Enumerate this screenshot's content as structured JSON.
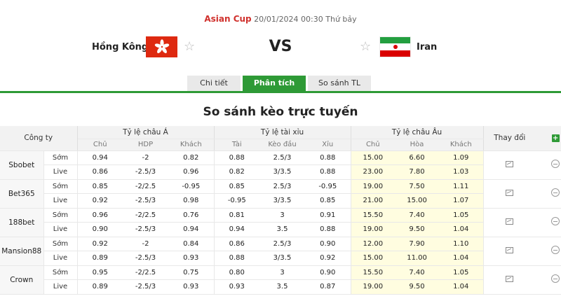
{
  "match": {
    "league": "Asian Cup",
    "datetime": "20/01/2024 00:30 Thứ bảy",
    "home_team": "Hồng Kông",
    "away_team": "Iran",
    "vs_label": "VS",
    "home_flag_icon": "hong-kong-flag-icon",
    "away_flag_icon": "iran-flag-icon"
  },
  "tabs": [
    {
      "label": "Chi tiết",
      "active": false
    },
    {
      "label": "Phân tích",
      "active": true
    },
    {
      "label": "So sánh TL",
      "active": false
    }
  ],
  "section_title": "So sánh kèo trực tuyến",
  "colors": {
    "accent": "#2e9a36",
    "league": "#d0312d",
    "european_bg": "#fffde0"
  },
  "table": {
    "company_header": "Công ty",
    "groups": [
      "Tỷ lệ châu Á",
      "Tỷ lệ tài xỉu",
      "Tỷ lệ châu Âu"
    ],
    "change_header": "Thay đổi",
    "subheaders": [
      "Chủ",
      "HDP",
      "Khách",
      "Tài",
      "Kèo đầu",
      "Xỉu",
      "Chủ",
      "Hòa",
      "Khách"
    ],
    "rows": [
      {
        "company": "Sbobet",
        "early": {
          "type": "Sớm",
          "values": [
            "0.94",
            "-2",
            "0.82",
            "0.88",
            "2.5/3",
            "0.88",
            "15.00",
            "6.60",
            "1.09"
          ]
        },
        "live": {
          "type": "Live",
          "values": [
            "0.86",
            "-2.5/3",
            "0.96",
            "0.82",
            "3/3.5",
            "0.88",
            "23.00",
            "7.80",
            "1.03"
          ]
        }
      },
      {
        "company": "Bet365",
        "early": {
          "type": "Sớm",
          "values": [
            "0.85",
            "-2/2.5",
            "-0.95",
            "0.85",
            "2.5/3",
            "-0.95",
            "19.00",
            "7.50",
            "1.11"
          ]
        },
        "live": {
          "type": "Live",
          "values": [
            "0.92",
            "-2.5/3",
            "0.98",
            "-0.95",
            "3/3.5",
            "0.85",
            "21.00",
            "15.00",
            "1.07"
          ]
        }
      },
      {
        "company": "188bet",
        "early": {
          "type": "Sớm",
          "values": [
            "0.96",
            "-2/2.5",
            "0.76",
            "0.81",
            "3",
            "0.91",
            "15.50",
            "7.40",
            "1.05"
          ]
        },
        "live": {
          "type": "Live",
          "values": [
            "0.90",
            "-2.5/3",
            "0.94",
            "0.94",
            "3.5",
            "0.88",
            "19.00",
            "9.50",
            "1.04"
          ]
        }
      },
      {
        "company": "Mansion88",
        "early": {
          "type": "Sớm",
          "values": [
            "0.92",
            "-2",
            "0.84",
            "0.86",
            "2.5/3",
            "0.90",
            "12.00",
            "7.90",
            "1.10"
          ]
        },
        "live": {
          "type": "Live",
          "values": [
            "0.89",
            "-2.5/3",
            "0.93",
            "0.88",
            "3/3.5",
            "0.92",
            "15.00",
            "11.00",
            "1.04"
          ]
        }
      },
      {
        "company": "Crown",
        "early": {
          "type": "Sớm",
          "values": [
            "0.95",
            "-2/2.5",
            "0.75",
            "0.80",
            "3",
            "0.90",
            "15.50",
            "7.40",
            "1.05"
          ]
        },
        "live": {
          "type": "Live",
          "values": [
            "0.89",
            "-2.5/3",
            "0.93",
            "0.93",
            "3.5",
            "0.87",
            "19.00",
            "9.50",
            "1.04"
          ]
        }
      }
    ]
  }
}
